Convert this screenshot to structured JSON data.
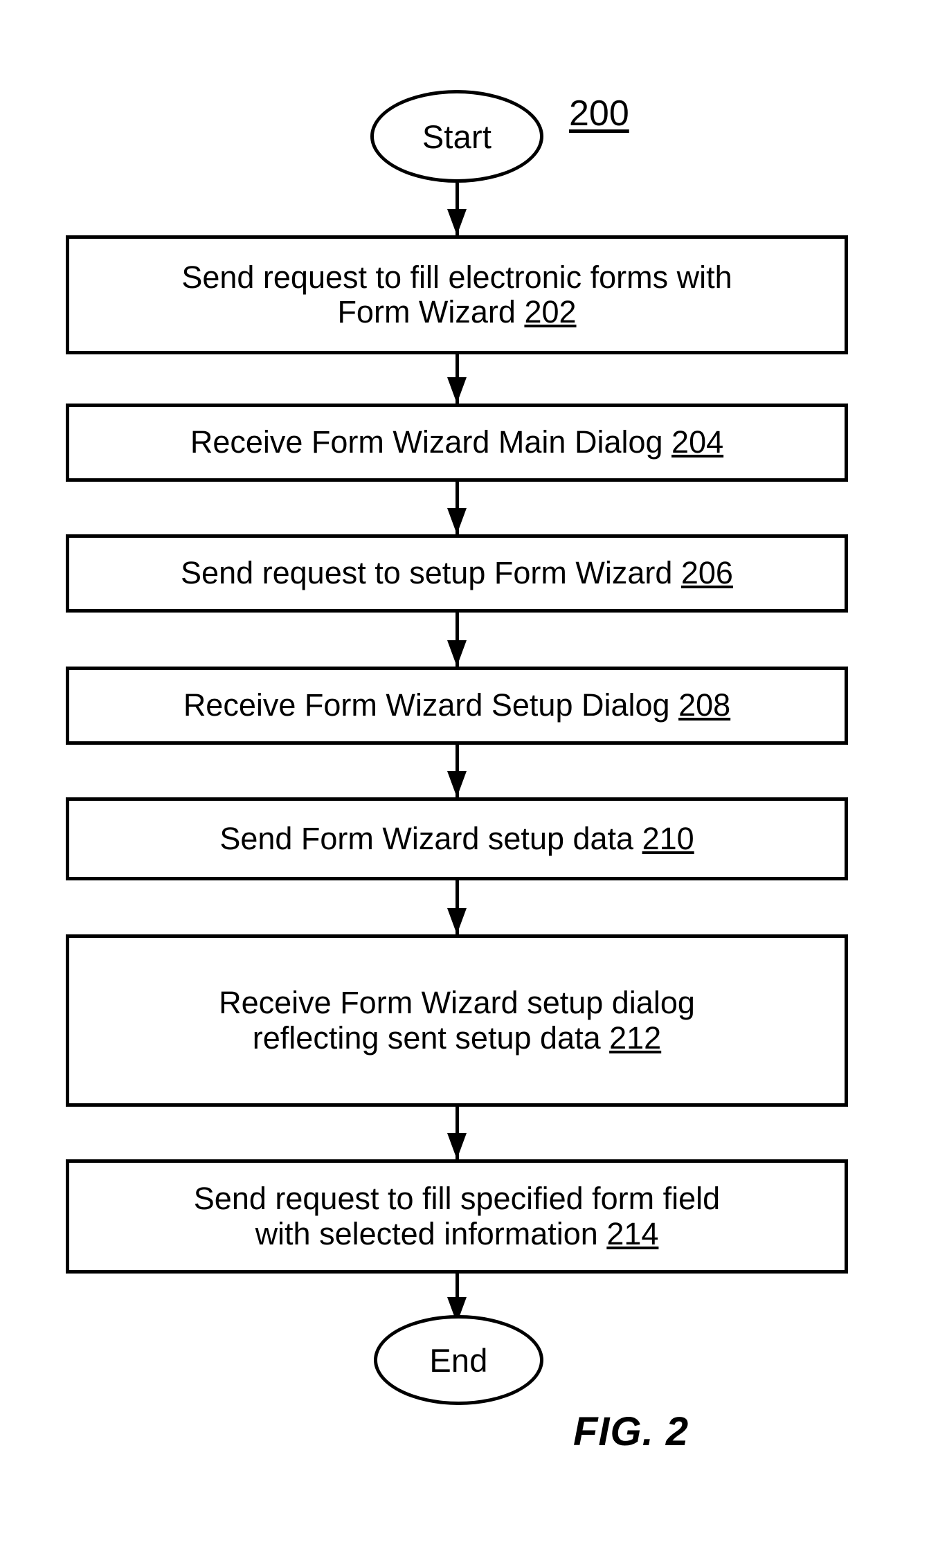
{
  "figure": {
    "caption": "FIG. 2",
    "diagram_number": "200"
  },
  "flowchart": {
    "type": "process-flow",
    "orientation": "vertical-top-to-bottom",
    "nodes": [
      {
        "id": "start",
        "shape": "ellipse",
        "label": "Start",
        "ref": ""
      },
      {
        "id": "step-202",
        "shape": "rectangle",
        "line1": "Send request to fill electronic forms with",
        "line2": "Form Wizard ",
        "ref": "202"
      },
      {
        "id": "step-204",
        "shape": "rectangle",
        "line1": "Receive Form Wizard Main Dialog ",
        "line2": "",
        "ref": "204"
      },
      {
        "id": "step-206",
        "shape": "rectangle",
        "line1": "Send request to setup Form Wizard ",
        "line2": "",
        "ref": "206"
      },
      {
        "id": "step-208",
        "shape": "rectangle",
        "line1": "Receive Form Wizard Setup Dialog ",
        "line2": "",
        "ref": "208"
      },
      {
        "id": "step-210",
        "shape": "rectangle",
        "line1": "Send Form Wizard setup data  ",
        "line2": "",
        "ref": "210"
      },
      {
        "id": "step-212",
        "shape": "rectangle",
        "line1": "Receive Form Wizard setup dialog",
        "line2": "reflecting sent setup data ",
        "ref": "212"
      },
      {
        "id": "step-214",
        "shape": "rectangle",
        "line1": "Send request to fill specified form field",
        "line2": "with selected information  ",
        "ref": "214"
      },
      {
        "id": "end",
        "shape": "ellipse",
        "label": "End",
        "ref": ""
      }
    ],
    "edges": [
      {
        "from": "start",
        "to": "step-202",
        "arrow": "filled-triangle"
      },
      {
        "from": "step-202",
        "to": "step-204",
        "arrow": "filled-triangle"
      },
      {
        "from": "step-204",
        "to": "step-206",
        "arrow": "filled-triangle"
      },
      {
        "from": "step-206",
        "to": "step-208",
        "arrow": "filled-triangle"
      },
      {
        "from": "step-208",
        "to": "step-210",
        "arrow": "filled-triangle"
      },
      {
        "from": "step-210",
        "to": "step-212",
        "arrow": "filled-triangle"
      },
      {
        "from": "step-212",
        "to": "step-214",
        "arrow": "filled-triangle"
      },
      {
        "from": "step-214",
        "to": "end",
        "arrow": "filled-triangle"
      }
    ]
  },
  "colors": {
    "stroke": "#000000",
    "fill": "#ffffff",
    "text": "#000000"
  }
}
